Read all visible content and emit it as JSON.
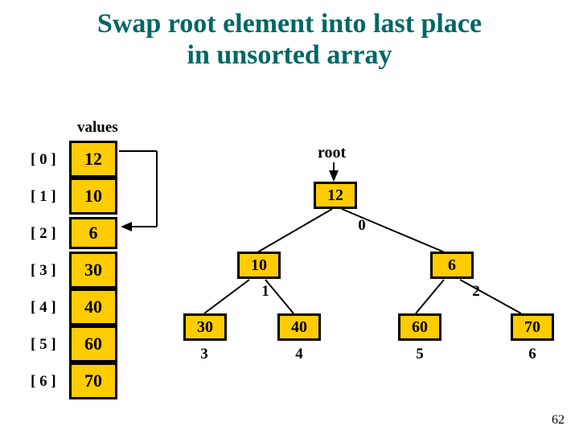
{
  "title_line1": "Swap root element into last place",
  "title_line2": "in unsorted array",
  "values_label": "values",
  "root_label": "root",
  "array": {
    "indices": [
      "[ 0 ]",
      "[ 1 ]",
      "[ 2 ]",
      "[ 3 ]",
      "[ 4 ]",
      "[ 5 ]",
      "[ 6 ]"
    ],
    "cells": [
      "12",
      "10",
      "6",
      "30",
      "40",
      "60",
      "70"
    ]
  },
  "tree": {
    "nodes": [
      {
        "value": "12",
        "index": "0"
      },
      {
        "value": "10",
        "index": "1"
      },
      {
        "value": "6",
        "index": "2"
      },
      {
        "value": "30",
        "index": "3"
      },
      {
        "value": "40",
        "index": "4"
      },
      {
        "value": "60",
        "index": "5"
      },
      {
        "value": "70",
        "index": "6"
      }
    ]
  },
  "page_number": "62"
}
